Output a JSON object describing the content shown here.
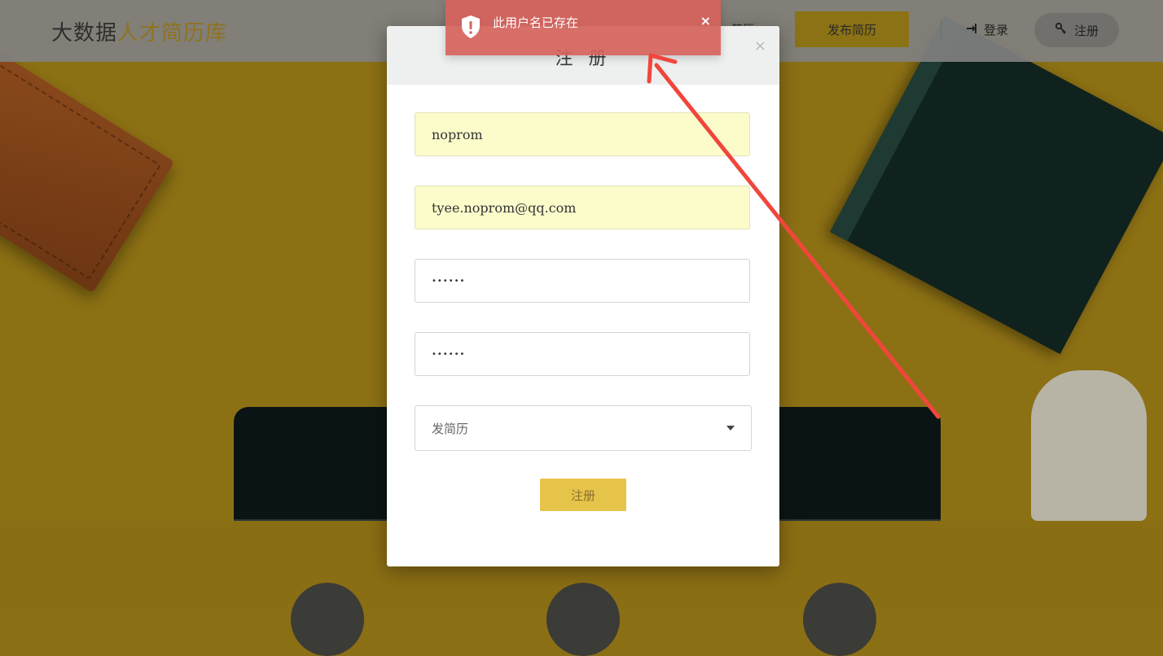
{
  "navbar": {
    "brand_part1": "大数据",
    "brand_part2": "人才简历库",
    "nav_item_partial": "简历",
    "publish_label": "发布简历",
    "login_label": "登录",
    "register_label": "注册"
  },
  "modal": {
    "title": "注 册",
    "close_symbol": "×",
    "username_value": "noprom",
    "email_value": "tyee.noprom@qq.com",
    "password_value": "••••••",
    "confirm_password_value": "••••••",
    "role_selected": "发简历",
    "submit_label": "注册"
  },
  "toast": {
    "message": "此用户名已存在",
    "close_symbol": "×"
  },
  "colors": {
    "accent": "#e6c44a",
    "navbar_button": "#8b7214",
    "toast_bg": "#d6635c",
    "autofill_bg": "#fcfccb",
    "annotation_arrow": "#f0463c"
  },
  "icons": {
    "toast": "shield-alert-icon",
    "login": "sign-in-icon",
    "register": "key-icon"
  }
}
